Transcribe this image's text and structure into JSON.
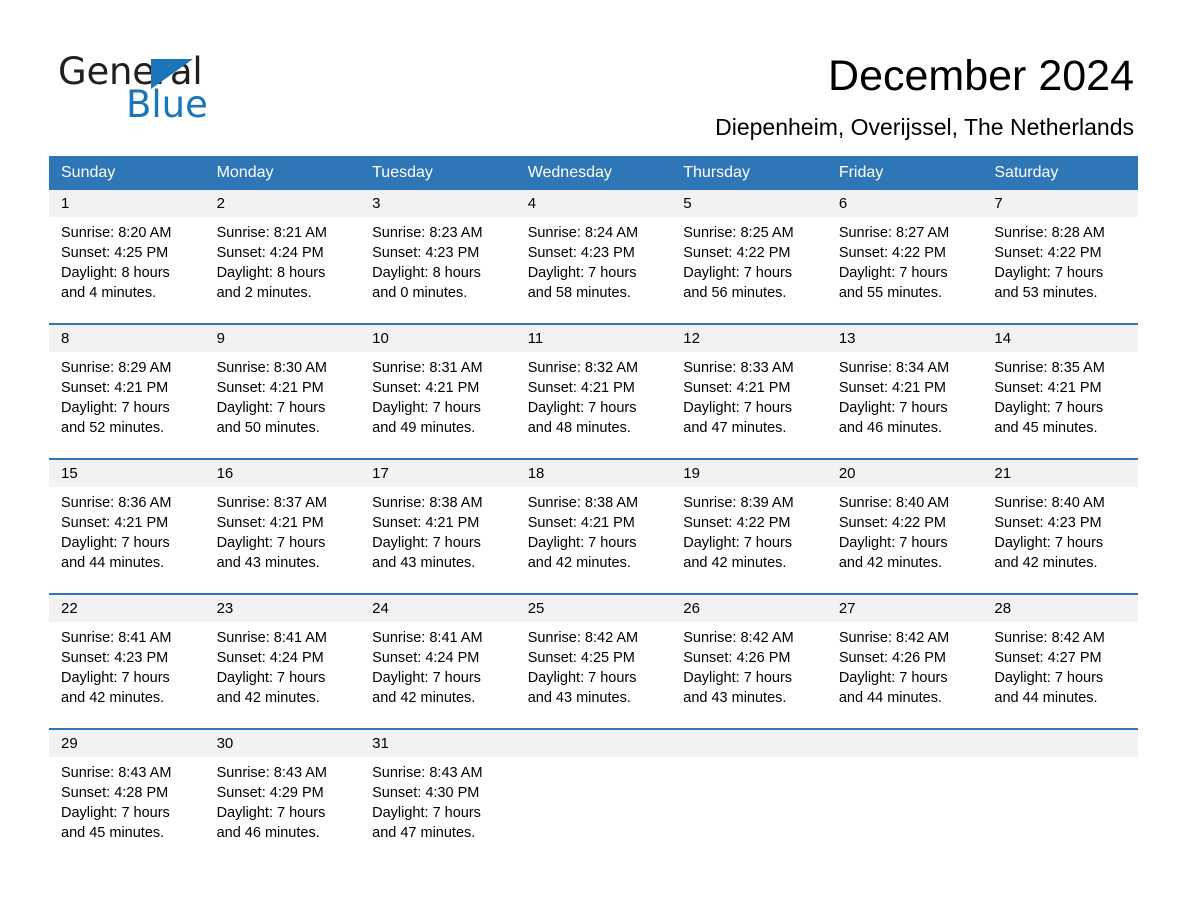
{
  "brand": {
    "name_top": "General",
    "name_bottom": "Blue",
    "color_blue": "#1b75bb",
    "logo_icon": "triangle-flag-icon"
  },
  "header": {
    "title": "December 2024",
    "subtitle": "Diepenheim, Overijssel, The Netherlands"
  },
  "calendar": {
    "header_bg": "#2e76b5",
    "daynum_bg": "#f2f2f2",
    "weekday_headers": [
      "Sunday",
      "Monday",
      "Tuesday",
      "Wednesday",
      "Thursday",
      "Friday",
      "Saturday"
    ],
    "weeks": [
      [
        {
          "day": "1",
          "sunrise": "Sunrise: 8:20 AM",
          "sunset": "Sunset: 4:25 PM",
          "daylight1": "Daylight: 8 hours",
          "daylight2": "and 4 minutes."
        },
        {
          "day": "2",
          "sunrise": "Sunrise: 8:21 AM",
          "sunset": "Sunset: 4:24 PM",
          "daylight1": "Daylight: 8 hours",
          "daylight2": "and 2 minutes."
        },
        {
          "day": "3",
          "sunrise": "Sunrise: 8:23 AM",
          "sunset": "Sunset: 4:23 PM",
          "daylight1": "Daylight: 8 hours",
          "daylight2": "and 0 minutes."
        },
        {
          "day": "4",
          "sunrise": "Sunrise: 8:24 AM",
          "sunset": "Sunset: 4:23 PM",
          "daylight1": "Daylight: 7 hours",
          "daylight2": "and 58 minutes."
        },
        {
          "day": "5",
          "sunrise": "Sunrise: 8:25 AM",
          "sunset": "Sunset: 4:22 PM",
          "daylight1": "Daylight: 7 hours",
          "daylight2": "and 56 minutes."
        },
        {
          "day": "6",
          "sunrise": "Sunrise: 8:27 AM",
          "sunset": "Sunset: 4:22 PM",
          "daylight1": "Daylight: 7 hours",
          "daylight2": "and 55 minutes."
        },
        {
          "day": "7",
          "sunrise": "Sunrise: 8:28 AM",
          "sunset": "Sunset: 4:22 PM",
          "daylight1": "Daylight: 7 hours",
          "daylight2": "and 53 minutes."
        }
      ],
      [
        {
          "day": "8",
          "sunrise": "Sunrise: 8:29 AM",
          "sunset": "Sunset: 4:21 PM",
          "daylight1": "Daylight: 7 hours",
          "daylight2": "and 52 minutes."
        },
        {
          "day": "9",
          "sunrise": "Sunrise: 8:30 AM",
          "sunset": "Sunset: 4:21 PM",
          "daylight1": "Daylight: 7 hours",
          "daylight2": "and 50 minutes."
        },
        {
          "day": "10",
          "sunrise": "Sunrise: 8:31 AM",
          "sunset": "Sunset: 4:21 PM",
          "daylight1": "Daylight: 7 hours",
          "daylight2": "and 49 minutes."
        },
        {
          "day": "11",
          "sunrise": "Sunrise: 8:32 AM",
          "sunset": "Sunset: 4:21 PM",
          "daylight1": "Daylight: 7 hours",
          "daylight2": "and 48 minutes."
        },
        {
          "day": "12",
          "sunrise": "Sunrise: 8:33 AM",
          "sunset": "Sunset: 4:21 PM",
          "daylight1": "Daylight: 7 hours",
          "daylight2": "and 47 minutes."
        },
        {
          "day": "13",
          "sunrise": "Sunrise: 8:34 AM",
          "sunset": "Sunset: 4:21 PM",
          "daylight1": "Daylight: 7 hours",
          "daylight2": "and 46 minutes."
        },
        {
          "day": "14",
          "sunrise": "Sunrise: 8:35 AM",
          "sunset": "Sunset: 4:21 PM",
          "daylight1": "Daylight: 7 hours",
          "daylight2": "and 45 minutes."
        }
      ],
      [
        {
          "day": "15",
          "sunrise": "Sunrise: 8:36 AM",
          "sunset": "Sunset: 4:21 PM",
          "daylight1": "Daylight: 7 hours",
          "daylight2": "and 44 minutes."
        },
        {
          "day": "16",
          "sunrise": "Sunrise: 8:37 AM",
          "sunset": "Sunset: 4:21 PM",
          "daylight1": "Daylight: 7 hours",
          "daylight2": "and 43 minutes."
        },
        {
          "day": "17",
          "sunrise": "Sunrise: 8:38 AM",
          "sunset": "Sunset: 4:21 PM",
          "daylight1": "Daylight: 7 hours",
          "daylight2": "and 43 minutes."
        },
        {
          "day": "18",
          "sunrise": "Sunrise: 8:38 AM",
          "sunset": "Sunset: 4:21 PM",
          "daylight1": "Daylight: 7 hours",
          "daylight2": "and 42 minutes."
        },
        {
          "day": "19",
          "sunrise": "Sunrise: 8:39 AM",
          "sunset": "Sunset: 4:22 PM",
          "daylight1": "Daylight: 7 hours",
          "daylight2": "and 42 minutes."
        },
        {
          "day": "20",
          "sunrise": "Sunrise: 8:40 AM",
          "sunset": "Sunset: 4:22 PM",
          "daylight1": "Daylight: 7 hours",
          "daylight2": "and 42 minutes."
        },
        {
          "day": "21",
          "sunrise": "Sunrise: 8:40 AM",
          "sunset": "Sunset: 4:23 PM",
          "daylight1": "Daylight: 7 hours",
          "daylight2": "and 42 minutes."
        }
      ],
      [
        {
          "day": "22",
          "sunrise": "Sunrise: 8:41 AM",
          "sunset": "Sunset: 4:23 PM",
          "daylight1": "Daylight: 7 hours",
          "daylight2": "and 42 minutes."
        },
        {
          "day": "23",
          "sunrise": "Sunrise: 8:41 AM",
          "sunset": "Sunset: 4:24 PM",
          "daylight1": "Daylight: 7 hours",
          "daylight2": "and 42 minutes."
        },
        {
          "day": "24",
          "sunrise": "Sunrise: 8:41 AM",
          "sunset": "Sunset: 4:24 PM",
          "daylight1": "Daylight: 7 hours",
          "daylight2": "and 42 minutes."
        },
        {
          "day": "25",
          "sunrise": "Sunrise: 8:42 AM",
          "sunset": "Sunset: 4:25 PM",
          "daylight1": "Daylight: 7 hours",
          "daylight2": "and 43 minutes."
        },
        {
          "day": "26",
          "sunrise": "Sunrise: 8:42 AM",
          "sunset": "Sunset: 4:26 PM",
          "daylight1": "Daylight: 7 hours",
          "daylight2": "and 43 minutes."
        },
        {
          "day": "27",
          "sunrise": "Sunrise: 8:42 AM",
          "sunset": "Sunset: 4:26 PM",
          "daylight1": "Daylight: 7 hours",
          "daylight2": "and 44 minutes."
        },
        {
          "day": "28",
          "sunrise": "Sunrise: 8:42 AM",
          "sunset": "Sunset: 4:27 PM",
          "daylight1": "Daylight: 7 hours",
          "daylight2": "and 44 minutes."
        }
      ],
      [
        {
          "day": "29",
          "sunrise": "Sunrise: 8:43 AM",
          "sunset": "Sunset: 4:28 PM",
          "daylight1": "Daylight: 7 hours",
          "daylight2": "and 45 minutes."
        },
        {
          "day": "30",
          "sunrise": "Sunrise: 8:43 AM",
          "sunset": "Sunset: 4:29 PM",
          "daylight1": "Daylight: 7 hours",
          "daylight2": "and 46 minutes."
        },
        {
          "day": "31",
          "sunrise": "Sunrise: 8:43 AM",
          "sunset": "Sunset: 4:30 PM",
          "daylight1": "Daylight: 7 hours",
          "daylight2": "and 47 minutes."
        },
        {
          "day": "",
          "sunrise": "",
          "sunset": "",
          "daylight1": "",
          "daylight2": ""
        },
        {
          "day": "",
          "sunrise": "",
          "sunset": "",
          "daylight1": "",
          "daylight2": ""
        },
        {
          "day": "",
          "sunrise": "",
          "sunset": "",
          "daylight1": "",
          "daylight2": ""
        },
        {
          "day": "",
          "sunrise": "",
          "sunset": "",
          "daylight1": "",
          "daylight2": ""
        }
      ]
    ]
  }
}
